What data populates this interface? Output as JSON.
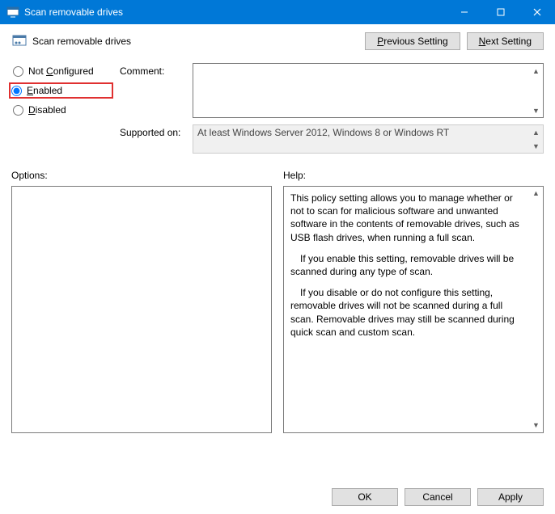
{
  "window": {
    "title": "Scan removable drives"
  },
  "header": {
    "policy_name": "Scan removable drives"
  },
  "nav_buttons": {
    "previous": "Previous Setting",
    "next": "Next Setting"
  },
  "radio": {
    "not_configured": "Not Configured",
    "enabled": "Enabled",
    "disabled": "Disabled",
    "selected": "enabled"
  },
  "fields": {
    "comment_label": "Comment:",
    "comment_value": "",
    "supported_label": "Supported on:",
    "supported_value": "At least Windows Server 2012, Windows 8 or Windows RT"
  },
  "lower": {
    "options_label": "Options:",
    "help_label": "Help:"
  },
  "help_text": {
    "p1": "This policy setting allows you to manage whether or not to scan for malicious software and unwanted software in the contents of removable drives, such as USB flash drives, when running a full scan.",
    "p2": "If you enable this setting, removable drives will be scanned during any type of scan.",
    "p3": "If you disable or do not configure this setting, removable drives will not be scanned during a full scan. Removable drives may still be scanned during quick scan and custom scan."
  },
  "footer_buttons": {
    "ok": "OK",
    "cancel": "Cancel",
    "apply": "Apply"
  }
}
